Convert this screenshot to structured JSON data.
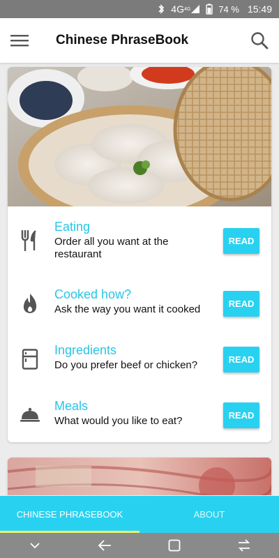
{
  "status_bar": {
    "network": "4G",
    "network_sup": "4G",
    "battery": "74 %",
    "time": "15:49"
  },
  "app_bar": {
    "title": "Chinese PhraseBook",
    "menu_icon": "hamburger-menu-icon",
    "search_icon": "search-icon"
  },
  "card": {
    "hero_image": "dumplings-in-bamboo-steamer",
    "items": [
      {
        "title": "Eating",
        "subtitle": "Order all you want at the restaurant",
        "icon": "fork-knife-icon",
        "button": "READ"
      },
      {
        "title": "Cooked how?",
        "subtitle": "Ask the way you want it cooked",
        "icon": "flame-icon",
        "button": "READ"
      },
      {
        "title": "Ingredients",
        "subtitle": "Do you prefer beef or chicken?",
        "icon": "fridge-icon",
        "button": "READ"
      },
      {
        "title": "Meals",
        "subtitle": "What would you like to eat?",
        "icon": "cloche-icon",
        "button": "READ"
      }
    ]
  },
  "second_card": {
    "image": "chinese-banknotes"
  },
  "tabs": [
    {
      "label": "CHINESE PHRASEBOOK",
      "active": true
    },
    {
      "label": "ABOUT",
      "active": false
    }
  ],
  "colors": {
    "accent": "#29D1F0",
    "title_accent": "#29C5E6",
    "tab_indicator": "#E6F36A",
    "status_bar": "#7B7B7B",
    "nav_bar": "#8A8A8A"
  }
}
